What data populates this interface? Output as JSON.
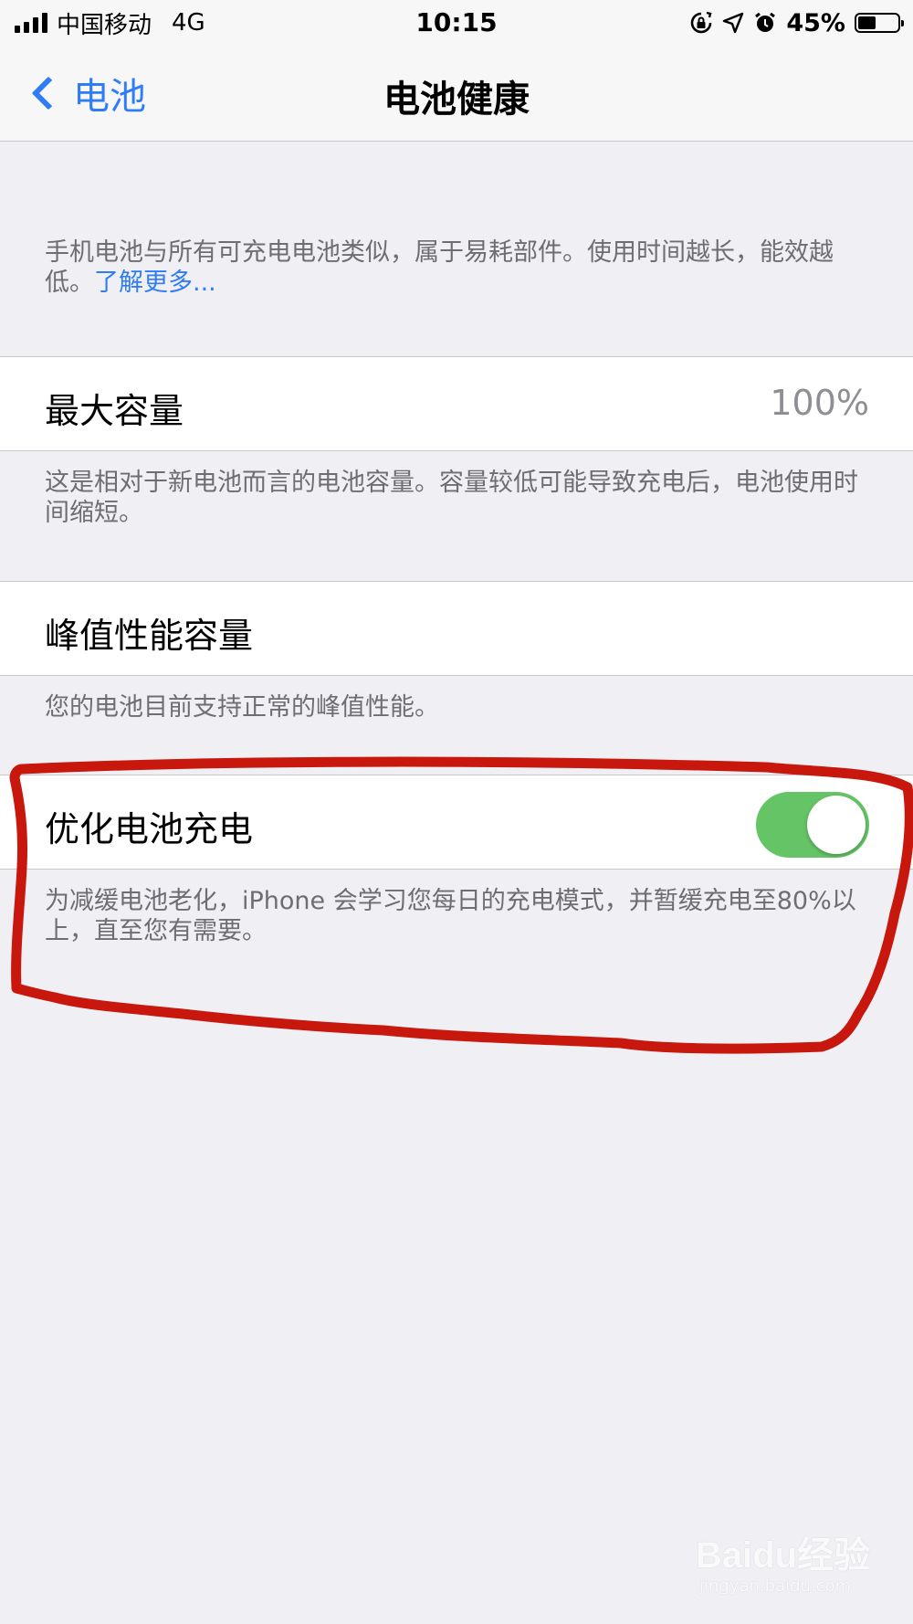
{
  "status_bar": {
    "carrier": "中国移动",
    "network": "4G",
    "time": "10:15",
    "battery_percent": "45%",
    "battery_level": 0.45,
    "icons": [
      "orientation-lock-icon",
      "location-arrow-icon",
      "alarm-icon"
    ]
  },
  "nav": {
    "back_label": "电池",
    "title": "电池健康"
  },
  "intro": {
    "text": "手机电池与所有可充电电池类似，属于易耗部件。使用时间越长，能效越低。",
    "link": "了解更多..."
  },
  "max_capacity": {
    "label": "最大容量",
    "value": "100%",
    "footer": "这是相对于新电池而言的电池容量。容量较低可能导致充电后，电池使用时间缩短。"
  },
  "peak_performance": {
    "label": "峰值性能容量",
    "footer": "您的电池目前支持正常的峰值性能。"
  },
  "optimized_charging": {
    "label": "优化电池充电",
    "enabled": true,
    "footer": "为减缓电池老化，iPhone 会学习您每日的充电模式，并暂缓充电至80%以上，直至您有需要。"
  },
  "watermark": {
    "brand": "Baidu经验",
    "url": "jingyan.baidu.com"
  },
  "colors": {
    "accent": "#2f7cf6",
    "toggle_on": "#65c466",
    "annotation": "#c8170d",
    "background": "#efeff4"
  }
}
